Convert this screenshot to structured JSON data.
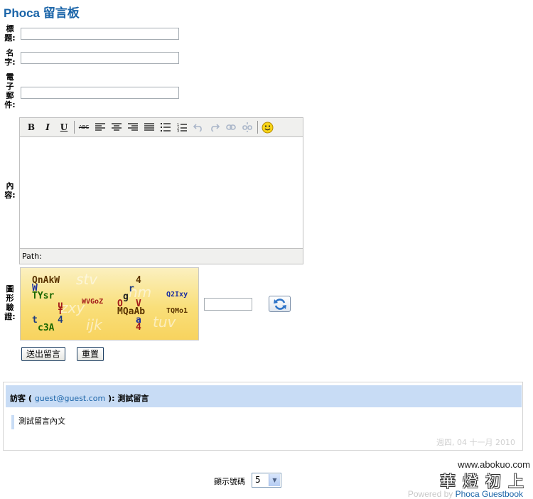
{
  "page_title": "Phoca 留言板",
  "form": {
    "title_label": "標題:",
    "name_label": "名字:",
    "email_label": "電子郵件:",
    "content_label": "內容:",
    "captcha_label": "圖形驗證:",
    "title_value": "",
    "name_value": "",
    "email_value": "",
    "captcha_value": "",
    "submit_label": "送出留言",
    "reset_label": "重置"
  },
  "editor": {
    "bold": "B",
    "italic": "I",
    "underline": "U",
    "strike": "ABC",
    "path_label": "Path:"
  },
  "captcha": {
    "words": [
      "QnAkW",
      "W",
      "TYsr",
      "u",
      "f",
      "WVGoZ",
      "4",
      "r",
      "g",
      "O",
      "V",
      "MQaAb",
      "Q2Ixy",
      "TQMo1",
      "t",
      "4",
      "c3A",
      "a",
      "4"
    ],
    "ghost_words": [
      "stv",
      "nm",
      "zxy",
      "ijk",
      "tuv"
    ]
  },
  "entry": {
    "author": "訪客",
    "open_paren": "( ",
    "email": "guest@guest.com",
    "close_paren": " ):",
    "subject": "測試留言",
    "body": "測試留言內文",
    "date": "週四, 04 十一月 2010"
  },
  "pager": {
    "label": "顯示號碼",
    "selected": "5"
  },
  "footer": {
    "site": "www.abokuo.com",
    "site_cn": "華燈初上",
    "powered_by": "Powered by",
    "product": "Phoca Guestbook"
  },
  "colors": {
    "accent": "#1a64a8",
    "entry_header": "#c8dcf5"
  }
}
